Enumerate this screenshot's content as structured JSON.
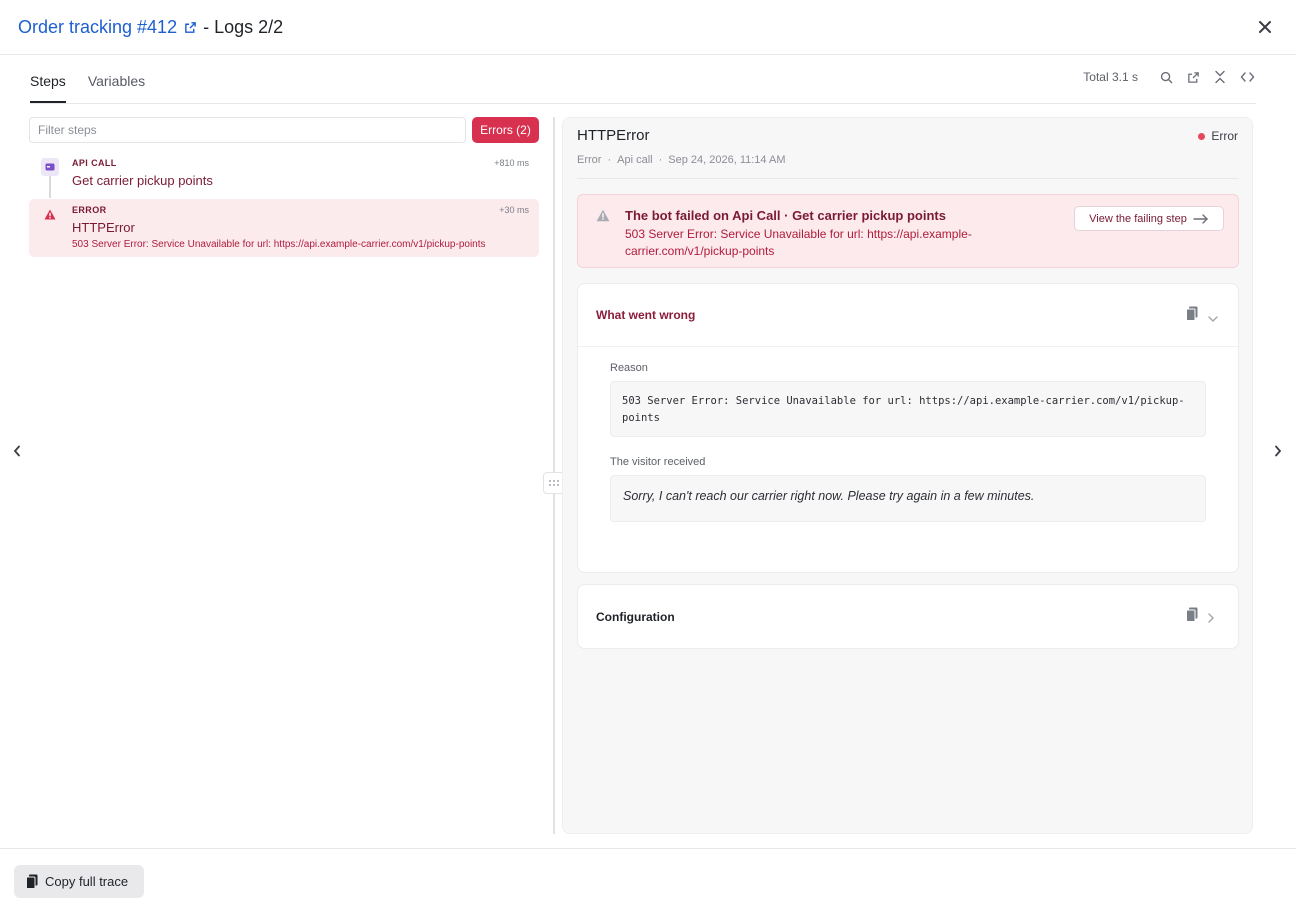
{
  "header": {
    "title_link": "Order tracking #412",
    "title_suffix": "- Logs 2/2"
  },
  "tabs": [
    {
      "label": "Steps",
      "active": true
    },
    {
      "label": "Variables",
      "active": false
    }
  ],
  "toolbar": {
    "total": "Total 3.1 s",
    "icons": [
      "search-icon",
      "external-link-icon",
      "collapse-icon",
      "code-icon"
    ]
  },
  "filter": {
    "placeholder": "Filter steps",
    "errors_label": "Errors (2)"
  },
  "steps": [
    {
      "type": "API CALL",
      "title": "Get carrier pickup points",
      "time": "+810 ms",
      "icon": "api-icon"
    },
    {
      "type": "ERROR",
      "title": "HTTPError",
      "time": "+30 ms",
      "description": "503 Server Error: Service Unavailable for url: https://api.example-carrier.com/v1/pickup-points",
      "icon": "warning-icon"
    }
  ],
  "detail": {
    "title": "HTTPError",
    "status": "Error",
    "meta": {
      "type": "Error",
      "category": "Api call",
      "timestamp": "Sep 24, 2026, 11:14 AM"
    },
    "alert": {
      "title": "The bot failed on Api Call · Get carrier pickup points",
      "message": "503 Server Error: Service Unavailable for url: https://api.example-carrier.com/v1/pickup-points",
      "button": "View the failing step"
    },
    "what_went_wrong": {
      "title": "What went wrong",
      "reason_label": "Reason",
      "reason": "503 Server Error: Service Unavailable for url: https://api.example-carrier.com/v1/pickup-points",
      "visitor_label": "The visitor received",
      "visitor_message": "Sorry, I can't reach our carrier right now. Please try again in a few minutes."
    },
    "configuration": {
      "title": "Configuration"
    }
  },
  "footer": {
    "copy_label": "Copy full trace"
  },
  "colors": {
    "accent_link": "#1d5fd1",
    "error": "#d8304f",
    "error_dark": "#7a1a35",
    "error_bg": "#fcebed"
  }
}
